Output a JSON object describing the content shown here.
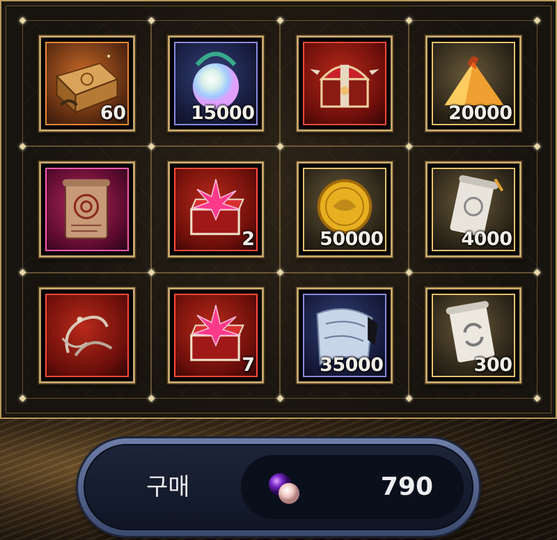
{
  "shop": {
    "items": [
      {
        "name": "ornate-chest",
        "rarity": "orange",
        "quantity": "60"
      },
      {
        "name": "spirit-orb",
        "rarity": "blue",
        "quantity": "15000"
      },
      {
        "name": "red-treasure-chest",
        "rarity": "red",
        "quantity": ""
      },
      {
        "name": "gold-pile",
        "rarity": "gold",
        "quantity": "20000"
      },
      {
        "name": "seal-scroll",
        "rarity": "pink",
        "quantity": ""
      },
      {
        "name": "crystal-box",
        "rarity": "red",
        "quantity": "2"
      },
      {
        "name": "gold-coin",
        "rarity": "gold",
        "quantity": "50000"
      },
      {
        "name": "rune-scroll",
        "rarity": "gold",
        "quantity": "4000"
      },
      {
        "name": "hook-rope",
        "rarity": "red",
        "quantity": ""
      },
      {
        "name": "crystal-box",
        "rarity": "red",
        "quantity": "7"
      },
      {
        "name": "silver-cloth",
        "rarity": "blue",
        "quantity": "35000"
      },
      {
        "name": "recycle-scroll",
        "rarity": "gold",
        "quantity": "300"
      }
    ]
  },
  "purchase": {
    "label": "구매",
    "currency_icon": "purple-gem-icon",
    "price": "790"
  },
  "colors": {
    "frame_gold": "#c4a46a",
    "bar_blue": "#5a6a94"
  }
}
